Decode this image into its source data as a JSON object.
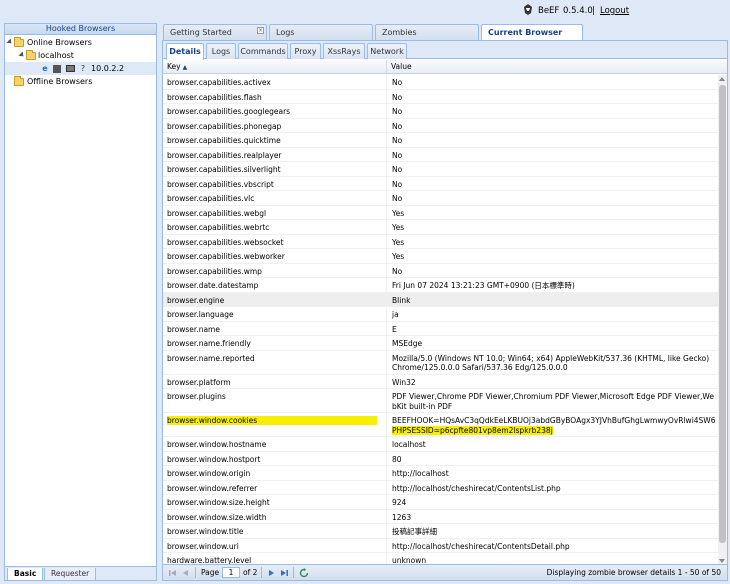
{
  "header": {
    "brand": "BeEF",
    "version": "0.5.4.0",
    "separator": "|",
    "logout": "Logout"
  },
  "left_panel": {
    "title": "Hooked Browsers",
    "online_label": "Online Browsers",
    "host_label": "localhost",
    "browser_ip": "10.0.2.2",
    "offline_label": "Offline Browsers",
    "tabs": [
      "Basic",
      "Requester"
    ]
  },
  "main_tabs": [
    "Getting Started",
    "Logs",
    "Zombies",
    "Current Browser"
  ],
  "sub_tabs": [
    "Details",
    "Logs",
    "Commands",
    "Proxy",
    "XssRays",
    "Network"
  ],
  "grid": {
    "key_header": "Key",
    "value_header": "Value",
    "rows": [
      {
        "k": "browser.capabilities.activex",
        "v": "No"
      },
      {
        "k": "browser.capabilities.flash",
        "v": "No"
      },
      {
        "k": "browser.capabilities.googlegears",
        "v": "No"
      },
      {
        "k": "browser.capabilities.phonegap",
        "v": "No"
      },
      {
        "k": "browser.capabilities.quicktime",
        "v": "No"
      },
      {
        "k": "browser.capabilities.realplayer",
        "v": "No"
      },
      {
        "k": "browser.capabilities.silverlight",
        "v": "No"
      },
      {
        "k": "browser.capabilities.vbscript",
        "v": "No"
      },
      {
        "k": "browser.capabilities.vlc",
        "v": "No"
      },
      {
        "k": "browser.capabilities.webgl",
        "v": "Yes"
      },
      {
        "k": "browser.capabilities.webrtc",
        "v": "Yes"
      },
      {
        "k": "browser.capabilities.websocket",
        "v": "Yes"
      },
      {
        "k": "browser.capabilities.webworker",
        "v": "Yes"
      },
      {
        "k": "browser.capabilities.wmp",
        "v": "No"
      },
      {
        "k": "browser.date.datestamp",
        "v": "Fri Jun 07 2024 13:21:23 GMT+0900 (日本標準時)"
      },
      {
        "k": "browser.engine",
        "v": "Blink"
      },
      {
        "k": "browser.language",
        "v": "ja"
      },
      {
        "k": "browser.name",
        "v": "E"
      },
      {
        "k": "browser.name.friendly",
        "v": "MSEdge"
      },
      {
        "k": "browser.name.reported",
        "v": "Mozilla/5.0 (Windows NT 10.0; Win64; x64) AppleWebKit/537.36 (KHTML, like Gecko) Chrome/125.0.0.0 Safari/537.36 Edg/125.0.0.0"
      },
      {
        "k": "browser.platform",
        "v": "Win32"
      },
      {
        "k": "browser.plugins",
        "v": "PDF Viewer,Chrome PDF Viewer,Chromium PDF Viewer,Microsoft Edge PDF Viewer,WebKit built-in PDF"
      },
      {
        "k": "browser.window.cookies",
        "v": "BEEFHOOK=HQsAvC3qQdkEeLKBUOj3abdGByBOAgx3YJVhBufGhgLwmwyOvRlwi4SW619...",
        "v2": "PHPSESSID=p6cpfte801vp8em2lspkrb238j"
      },
      {
        "k": "browser.window.hostname",
        "v": "localhost"
      },
      {
        "k": "browser.window.hostport",
        "v": "80"
      },
      {
        "k": "browser.window.origin",
        "v": "http://localhost"
      },
      {
        "k": "browser.window.referrer",
        "v": "http://localhost/cheshirecat/ContentsList.php"
      },
      {
        "k": "browser.window.size.height",
        "v": "924"
      },
      {
        "k": "browser.window.size.width",
        "v": "1263"
      },
      {
        "k": "browser.window.title",
        "v": "投稿記事詳細"
      },
      {
        "k": "browser.window.uri",
        "v": "http://localhost/cheshirecat/ContentsDetail.php"
      },
      {
        "k": "hardware.battery.level",
        "v": "unknown"
      }
    ]
  },
  "pager": {
    "page_label": "Page",
    "page_value": "1",
    "of_label": "of 2",
    "display": "Displaying zombie browser details 1 - 50 of 50"
  },
  "colors": {
    "highlight": "#f8ef00",
    "border": "#99bbe8",
    "background": "#dfe8f6"
  }
}
